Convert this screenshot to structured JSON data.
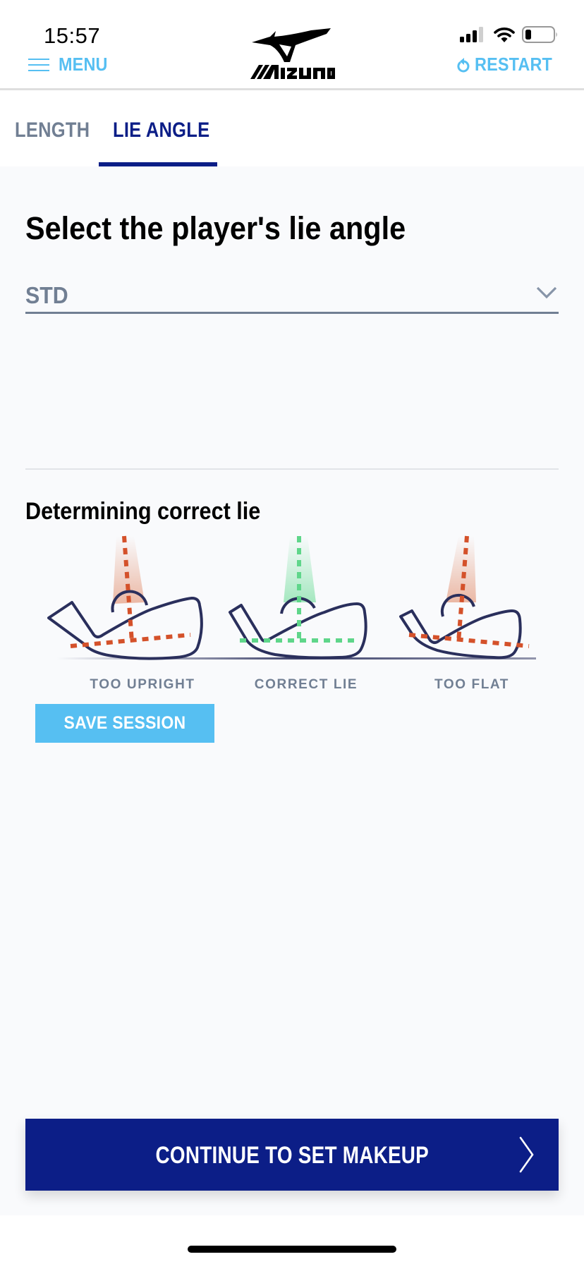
{
  "status_bar": {
    "time": "15:57",
    "icons": [
      "cellular-signal-icon",
      "wifi-icon",
      "battery-icon"
    ]
  },
  "header": {
    "menu_label": "MENU",
    "menu_icon": "hamburger-icon",
    "logo_text": "MIZUNO",
    "restart_label": "RESTART",
    "restart_icon": "restart-icon"
  },
  "tabs": [
    {
      "label": "LENGTH",
      "active": false
    },
    {
      "label": "LIE ANGLE",
      "active": true
    }
  ],
  "main": {
    "title": "Select the player's lie angle",
    "select": {
      "value": "STD",
      "icon": "chevron-down-icon"
    },
    "section_title": "Determining correct lie",
    "diagrams": [
      {
        "label": "TOO UPRIGHT",
        "status": "incorrect"
      },
      {
        "label": "CORRECT LIE",
        "status": "correct"
      },
      {
        "label": "TOO FLAT",
        "status": "incorrect"
      }
    ],
    "save_label": "SAVE SESSION",
    "continue_label": "CONTINUE TO SET MAKEUP",
    "continue_icon": "chevron-right-icon"
  },
  "colors": {
    "brand_navy": "#0c1e87",
    "accent_blue": "#56bff2",
    "muted_gray": "#717f93",
    "incorrect": "#d4512a",
    "correct": "#5fd68a",
    "club_outline": "#2a2f5c",
    "background": "#f9fafc"
  }
}
